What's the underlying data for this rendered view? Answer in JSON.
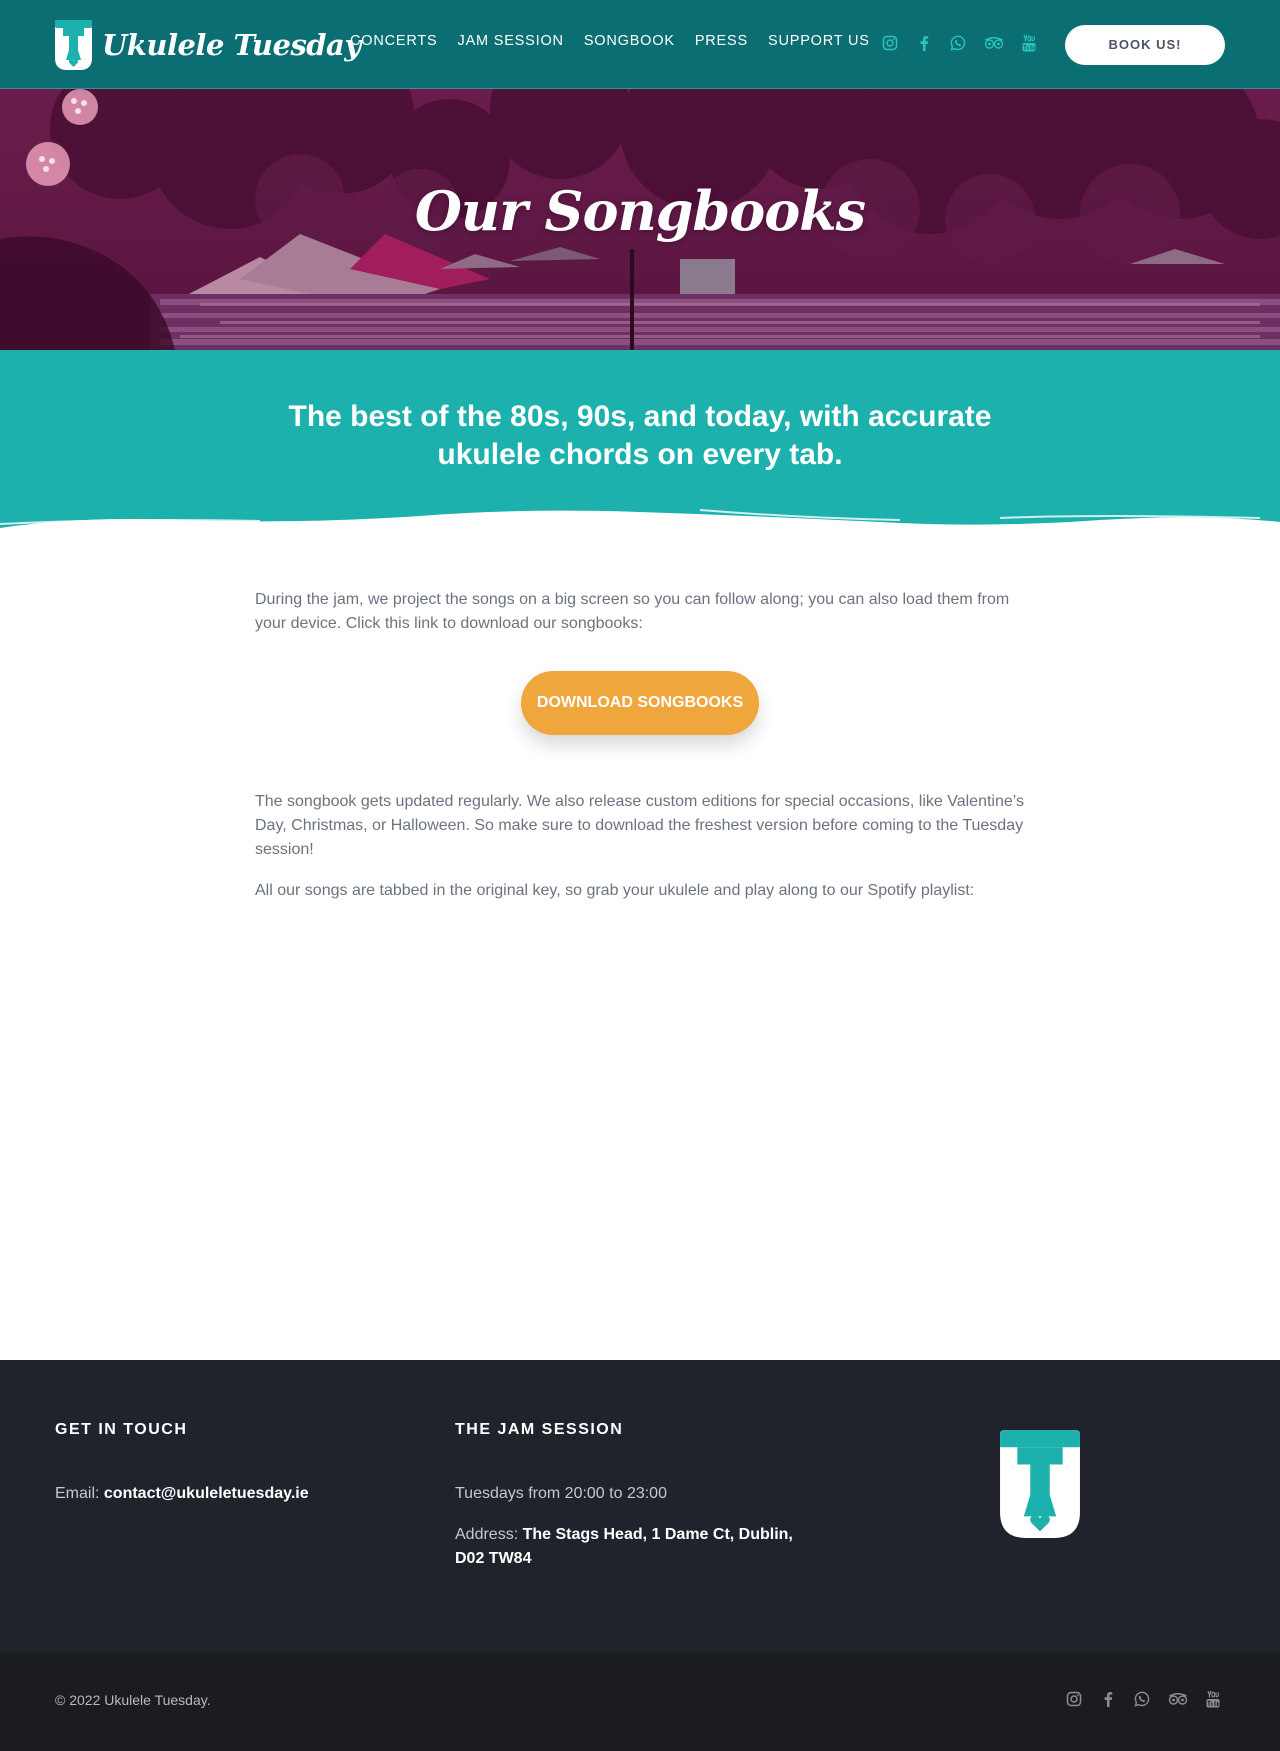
{
  "header": {
    "logo_text": "Ukulele Tuesday",
    "nav": [
      "CONCERTS",
      "JAM SESSION",
      "SONGBOOK",
      "PRESS",
      "SUPPORT US"
    ],
    "socials": [
      "instagram-icon",
      "facebook-icon",
      "whatsapp-icon",
      "tripadvisor-icon",
      "youtube-icon"
    ],
    "book_label": "BOOK US!"
  },
  "hero": {
    "title": "Our Songbooks"
  },
  "band": {
    "headline": "The best of the 80s, 90s, and today, with accurate ukulele chords on every tab."
  },
  "content": {
    "intro": "During the jam, we project the songs on a big screen so you can follow along; you can also load them from your device. Click this link to download our songbooks:",
    "download_label": "DOWNLOAD SONGBOOKS",
    "para2": "The songbook gets updated regularly. We also release custom editions for  special occasions, like Valentine’s Day, Christmas, or Halloween. So make sure to download the freshest version before coming to the Tuesday session!",
    "para3": "All our songs are tabbed in the original key, so grab your ukulele and play along to our Spotify playlist:"
  },
  "footer": {
    "contact_heading": "GET IN TOUCH",
    "email_label": "Email:",
    "email": "contact@ukuleletuesday.ie",
    "jam_heading": "THE JAM SESSION",
    "schedule": "Tuesdays from 20:00 to 23:00",
    "address_label": "Address:",
    "address": "The Stags Head, 1 Dame Ct, Dublin, D02 TW84"
  },
  "bottom": {
    "copyright": "© 2022 Ukulele Tuesday."
  },
  "colors": {
    "header_bg": "#0a6e72",
    "teal": "#1db1ad",
    "hero_overlay": "#5a1442",
    "accent_orange": "#efa63c",
    "footer_bg": "#20232b",
    "bottom_bg": "#1b1c1f"
  }
}
